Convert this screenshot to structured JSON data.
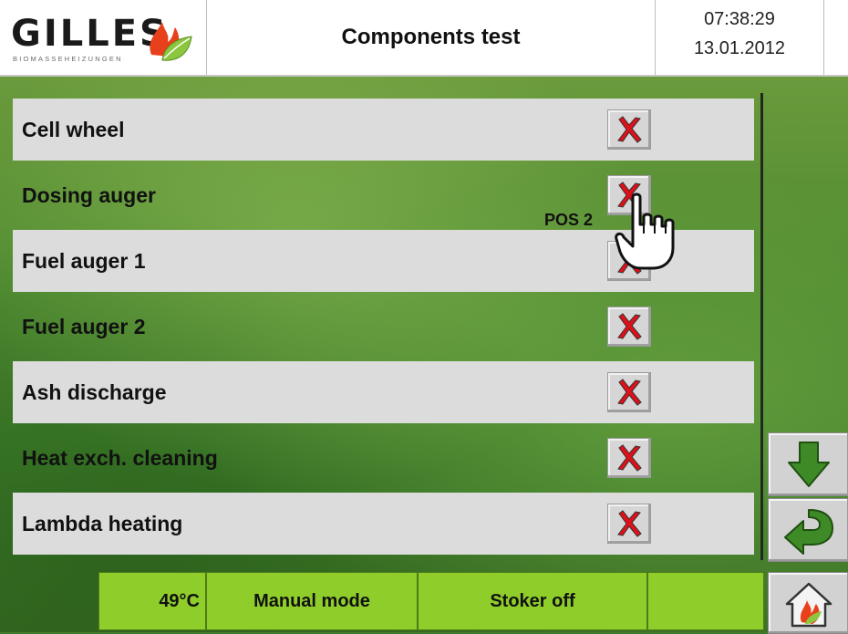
{
  "header": {
    "logo_text": "GILLES",
    "logo_subtext": "BIOMASSEHEIZUNGEN",
    "title": "Components test",
    "time": "07:38:29",
    "date": "13.01.2012"
  },
  "components": [
    {
      "label": "Cell wheel",
      "state_icon": "red-x-icon"
    },
    {
      "label": "Dosing auger",
      "state_icon": "red-x-icon"
    },
    {
      "label": "Fuel auger 1",
      "state_icon": "red-x-icon"
    },
    {
      "label": "Fuel auger 2",
      "state_icon": "red-x-icon"
    },
    {
      "label": "Ash discharge",
      "state_icon": "red-x-icon"
    },
    {
      "label": "Heat exch. cleaning",
      "state_icon": "red-x-icon"
    },
    {
      "label": "Lambda heating",
      "state_icon": "red-x-icon"
    }
  ],
  "pointer": {
    "label": "POS 2",
    "icon": "hand-pointer-icon"
  },
  "side": {
    "scroll_down_icon": "arrow-down-icon",
    "back_icon": "return-arrow-icon",
    "home_icon": "home-flame-icon"
  },
  "status": {
    "temperature": "49°C",
    "mode": "Manual mode",
    "stoker": "Stoker off",
    "extra": ""
  },
  "colors": {
    "status_bar": "#8fce2a",
    "row_light": "#dcdcdc",
    "x_red": "#e0101a",
    "arrow_green": "#3e8a26"
  }
}
